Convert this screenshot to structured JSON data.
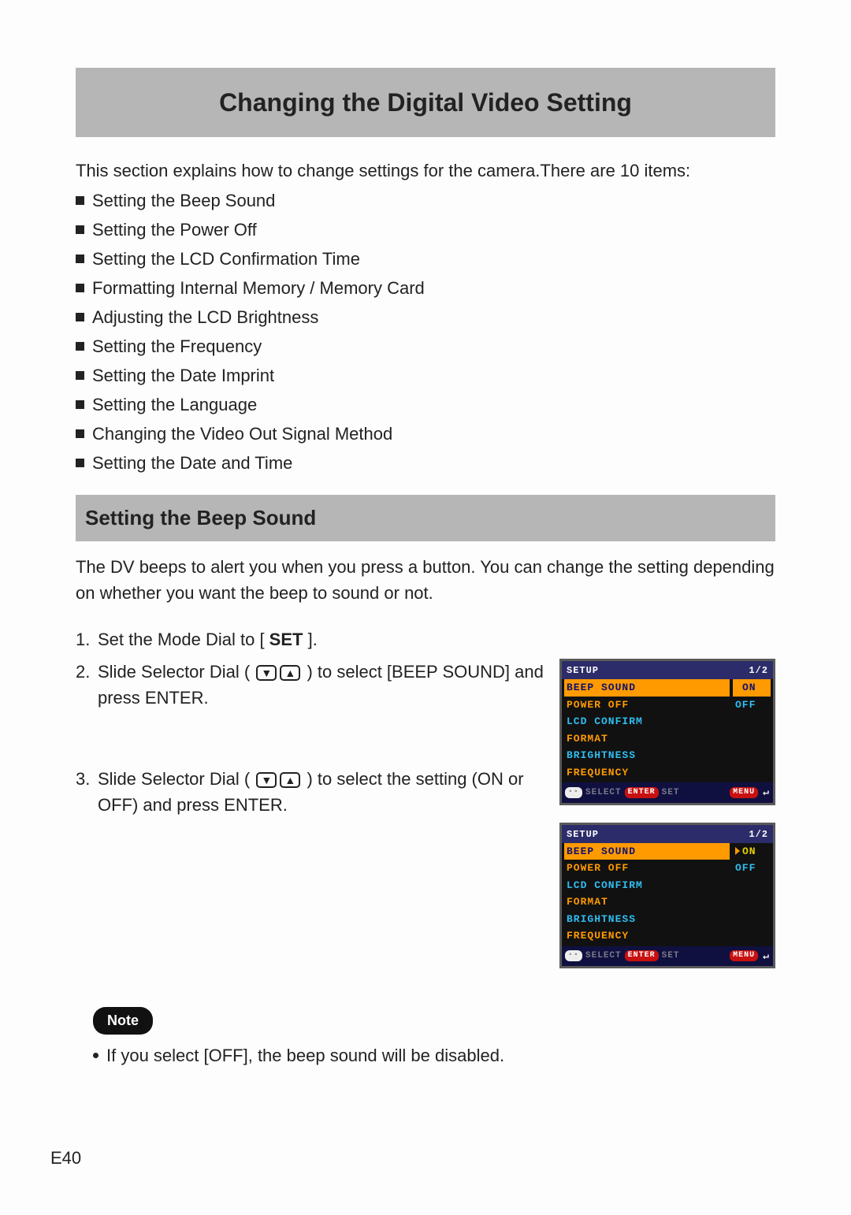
{
  "title": "Changing the Digital Video Setting",
  "intro": "This section explains how to change settings for the camera.There are 10 items:",
  "bullets": [
    "Setting the Beep Sound",
    "Setting the Power Off",
    "Setting the LCD Confirmation Time",
    "Formatting Internal Memory / Memory Card",
    "Adjusting the LCD Brightness",
    "Setting the Frequency",
    "Setting the Date Imprint",
    "Setting the Language",
    "Changing the Video Out Signal Method",
    "Setting the Date and Time"
  ],
  "subheading": "Setting the Beep Sound",
  "para": "The DV beeps to alert you when you press a button. You can change the setting depending on whether you want the beep to sound or not.",
  "steps": {
    "s1_pre": "Set the Mode Dial to [ ",
    "s1_bold": "SET",
    "s1_post": " ].",
    "s2_pre": "Slide Selector Dial ( ",
    "s2_post": " ) to select [BEEP SOUND] and press ENTER.",
    "s3_pre": "Slide Selector Dial ( ",
    "s3_post": " ) to select the setting (ON or OFF) and press ENTER."
  },
  "note_label": "Note",
  "notes": [
    "If you select [OFF], the beep sound will be disabled."
  ],
  "page_number": "E40",
  "lcd": {
    "header_title": "SETUP",
    "header_page": "1/2",
    "menu": [
      "BEEP SOUND",
      "POWER OFF",
      "LCD CONFIRM",
      "FORMAT",
      "BRIGHTNESS",
      "FREQUENCY"
    ],
    "options": [
      "ON",
      "OFF"
    ],
    "footer_select": "SELECT",
    "footer_set": "SET",
    "footer_enter": "ENTER",
    "footer_menu": "MENU"
  }
}
